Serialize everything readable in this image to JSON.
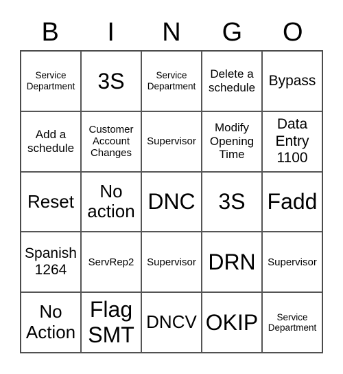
{
  "header": [
    "B",
    "I",
    "N",
    "G",
    "O"
  ],
  "cells": [
    {
      "text": "Service Department",
      "size": "s-xs"
    },
    {
      "text": "3S",
      "size": "s-xxl"
    },
    {
      "text": "Service Department",
      "size": "s-xs"
    },
    {
      "text": "Delete a schedule",
      "size": "s-md"
    },
    {
      "text": "Bypass",
      "size": "s-lg"
    },
    {
      "text": "Add a schedule",
      "size": "s-md"
    },
    {
      "text": "Customer Account Changes",
      "size": "s-sm"
    },
    {
      "text": "Supervisor",
      "size": "s-sm"
    },
    {
      "text": "Modify Opening Time",
      "size": "s-md"
    },
    {
      "text": "Data Entry 1100",
      "size": "s-lg"
    },
    {
      "text": "Reset",
      "size": "s-xl"
    },
    {
      "text": "No action",
      "size": "s-xl"
    },
    {
      "text": "DNC",
      "size": "s-xxl"
    },
    {
      "text": "3S",
      "size": "s-xxl"
    },
    {
      "text": "Fadd",
      "size": "s-xxl"
    },
    {
      "text": "Spanish 1264",
      "size": "s-lg"
    },
    {
      "text": "ServRep2",
      "size": "s-sm"
    },
    {
      "text": "Supervisor",
      "size": "s-sm"
    },
    {
      "text": "DRN",
      "size": "s-xxl"
    },
    {
      "text": "Supervisor",
      "size": "s-sm"
    },
    {
      "text": "No Action",
      "size": "s-xl"
    },
    {
      "text": "Flag SMT",
      "size": "s-xxl"
    },
    {
      "text": "DNCV",
      "size": "s-xl"
    },
    {
      "text": "OKIP",
      "size": "s-xxl"
    },
    {
      "text": "Service Department",
      "size": "s-xs"
    }
  ]
}
